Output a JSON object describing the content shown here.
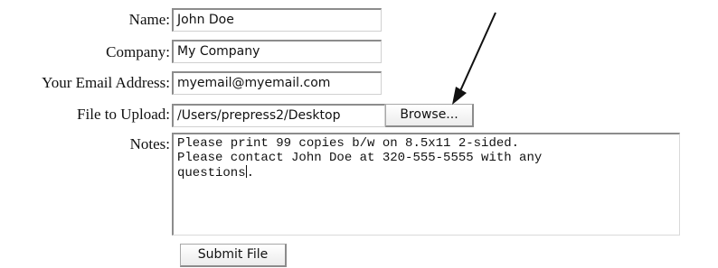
{
  "form": {
    "name": {
      "label": "Name:",
      "value": "John Doe"
    },
    "company": {
      "label": "Company:",
      "value": "My Company"
    },
    "email": {
      "label": "Your Email Address:",
      "value": "myemail@myemail.com"
    },
    "file": {
      "label": "File to Upload:",
      "value": "/Users/prepress2/Desktop",
      "browse_label": "Browse..."
    },
    "notes": {
      "label": "Notes:",
      "lines": [
        "Please print 99 copies b/w on 8.5x11 2-sided.",
        "Please contact John Doe at 320-555-5555 with any",
        "questions"
      ]
    },
    "submit_label": "Submit File"
  }
}
